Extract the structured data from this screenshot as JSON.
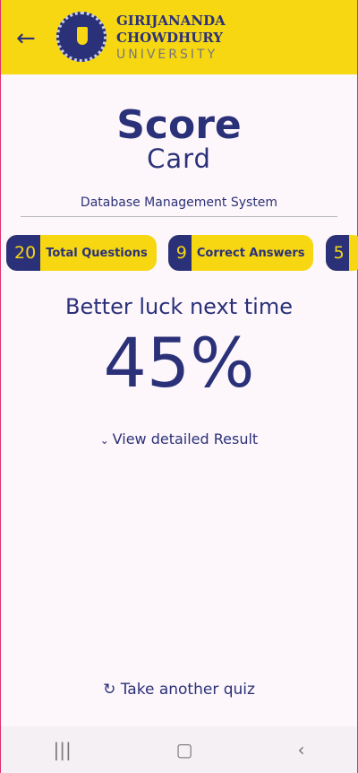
{
  "header": {
    "back_icon": "arrow-left-icon",
    "logo_line1": "GIRIJANANDA",
    "logo_line2": "CHOWDHURY",
    "logo_line3": "UNIVERSITY"
  },
  "title": {
    "line1": "Score",
    "line2": "Card"
  },
  "subject": "Database Management System",
  "stats": [
    {
      "value": "20",
      "label": "Total Questions"
    },
    {
      "value": "9",
      "label": "Correct Answers"
    },
    {
      "value": "5",
      "label": ""
    }
  ],
  "result": {
    "message": "Better luck next time",
    "percent": "45%",
    "detail_link": "View detailed Result"
  },
  "retake": "Take another quiz",
  "colors": {
    "brand_yellow": "#f6d712",
    "brand_navy": "#2b3179"
  },
  "nav": {
    "recents": "|||",
    "home": "▢",
    "back": "‹"
  }
}
